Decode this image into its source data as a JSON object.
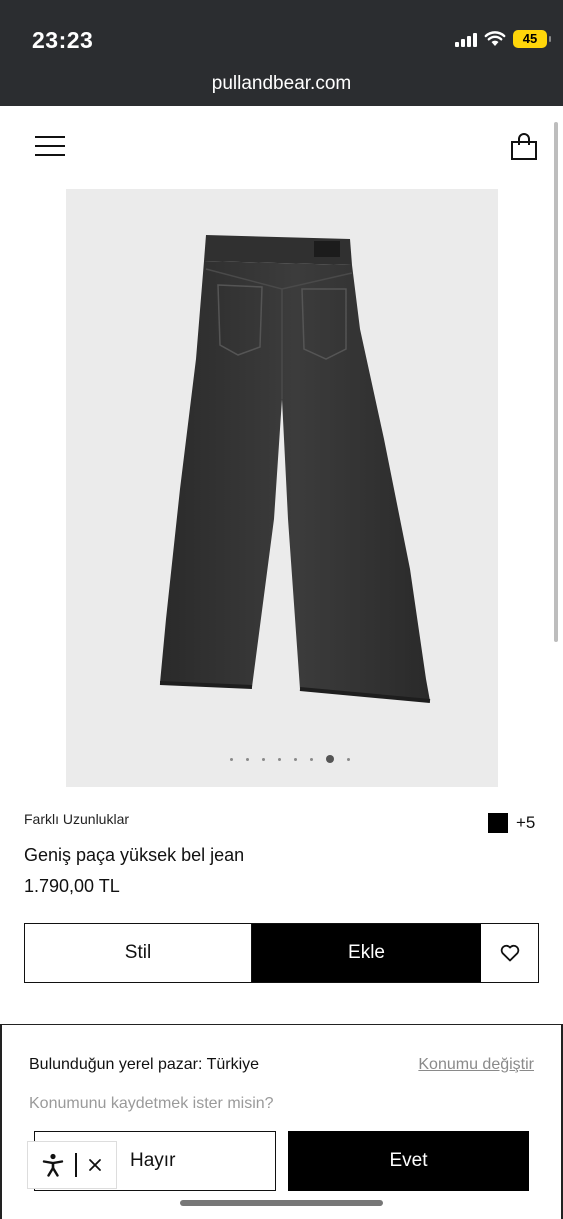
{
  "status_bar": {
    "time": "23:23",
    "battery": "45",
    "battery_color": "#ffd60a"
  },
  "browser": {
    "url": "pullandbear.com"
  },
  "header": {
    "menu_icon": "hamburger-menu-icon",
    "bag_icon": "shopping-bag-icon"
  },
  "gallery": {
    "image_count": 8,
    "active_index": 6
  },
  "product": {
    "subtitle": "Farklı Uzunluklar",
    "color_swatch": "#000000",
    "more_colors": "+5",
    "title": "Geniş paça yüksek bel jean",
    "price": "1.790,00 TL"
  },
  "actions": {
    "style_label": "Stil",
    "add_label": "Ekle",
    "favorite_icon": "heart-icon"
  },
  "location_banner": {
    "market_text": "Bulunduğun yerel pazar: Türkiye",
    "change_location": "Konumu değiştir",
    "save_question": "Konumunu kaydetmek ister misin?",
    "no_label": "Hayır",
    "yes_label": "Evet"
  },
  "accessibility_widget": {
    "icon": "accessibility-icon",
    "close_icon": "close-icon"
  }
}
